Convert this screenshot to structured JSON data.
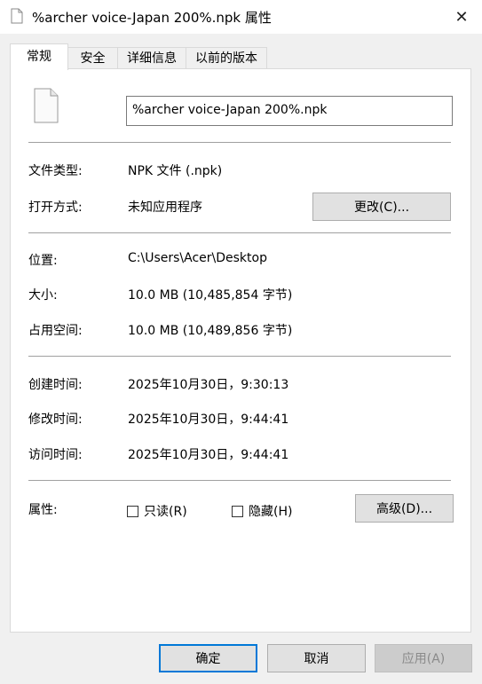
{
  "window": {
    "title": "%archer voice-Japan 200%.npk 属性",
    "close_glyph": "✕"
  },
  "tabs": [
    {
      "label": "常规",
      "active": true
    },
    {
      "label": "安全"
    },
    {
      "label": "详细信息"
    },
    {
      "label": "以前的版本"
    }
  ],
  "general": {
    "filename": "%archer voice-Japan 200%.npk",
    "type_label": "文件类型:",
    "type_value": "NPK 文件 (.npk)",
    "open_with_label": "打开方式:",
    "open_with_value": "未知应用程序",
    "change_button": "更改(C)...",
    "location_label": "位置:",
    "location_value": "C:\\Users\\Acer\\Desktop",
    "size_label": "大小:",
    "size_value": "10.0 MB (10,485,854 字节)",
    "size_on_disk_label": "占用空间:",
    "size_on_disk_value": "10.0 MB (10,489,856 字节)",
    "created_label": "创建时间:",
    "created_value": "2025年10月30日，9:30:13",
    "modified_label": "修改时间:",
    "modified_value": "2025年10月30日，9:44:41",
    "accessed_label": "访问时间:",
    "accessed_value": "2025年10月30日，9:44:41",
    "attributes_label": "属性:",
    "readonly_label": "只读(R)",
    "hidden_label": "隐藏(H)",
    "advanced_button": "高级(D)..."
  },
  "footer": {
    "ok": "确定",
    "cancel": "取消",
    "apply": "应用(A)"
  },
  "icons": {
    "title": "file-icon",
    "document": "file-icon",
    "close": "close-icon"
  }
}
